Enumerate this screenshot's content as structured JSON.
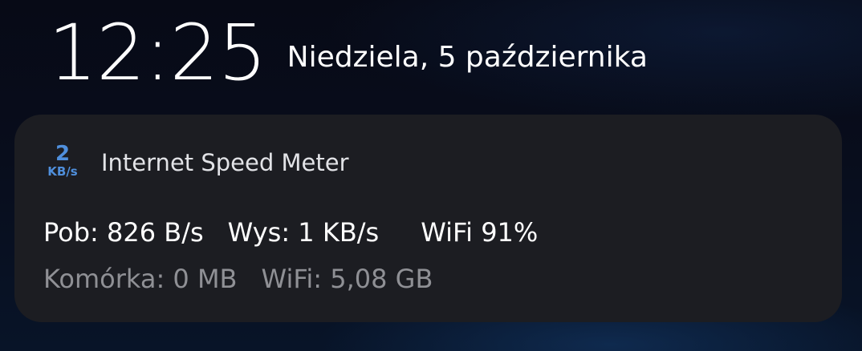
{
  "lockscreen": {
    "time": "12:25",
    "date": "Niedziela, 5 października"
  },
  "notification": {
    "app_icon": {
      "value": "2",
      "unit": "KB/s",
      "color": "#4f8fdc"
    },
    "app_name": "Internet Speed Meter",
    "download": "Pob: 826 B/s",
    "upload": "Wys: 1 KB/s",
    "wifi_signal": "WiFi 91%",
    "mobile_usage": "Komórka: 0 MB",
    "wifi_usage": "WiFi: 5,08 GB"
  }
}
